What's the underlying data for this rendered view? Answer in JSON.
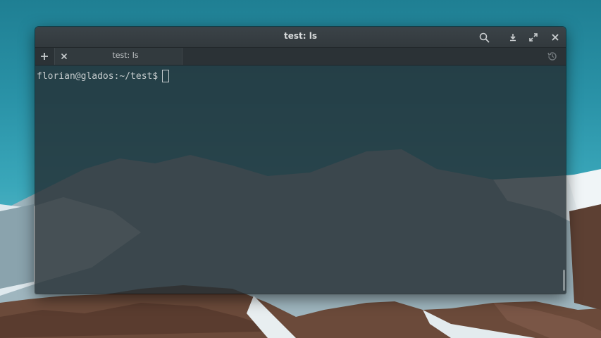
{
  "window": {
    "title": "test: ls"
  },
  "titlebar": {
    "buttons": [
      {
        "name": "search-icon"
      },
      {
        "name": "download-icon"
      },
      {
        "name": "maximize-icon"
      },
      {
        "name": "close-icon"
      }
    ]
  },
  "tabs": [
    {
      "label": "test: ls",
      "active": true
    }
  ],
  "terminal": {
    "prompt": "florian@glados:~/test$"
  },
  "colors": {
    "sky": "#2a93a8",
    "titlebar": "#353c40",
    "terminal_bg": "#252e33",
    "text": "#c5cbcd"
  }
}
